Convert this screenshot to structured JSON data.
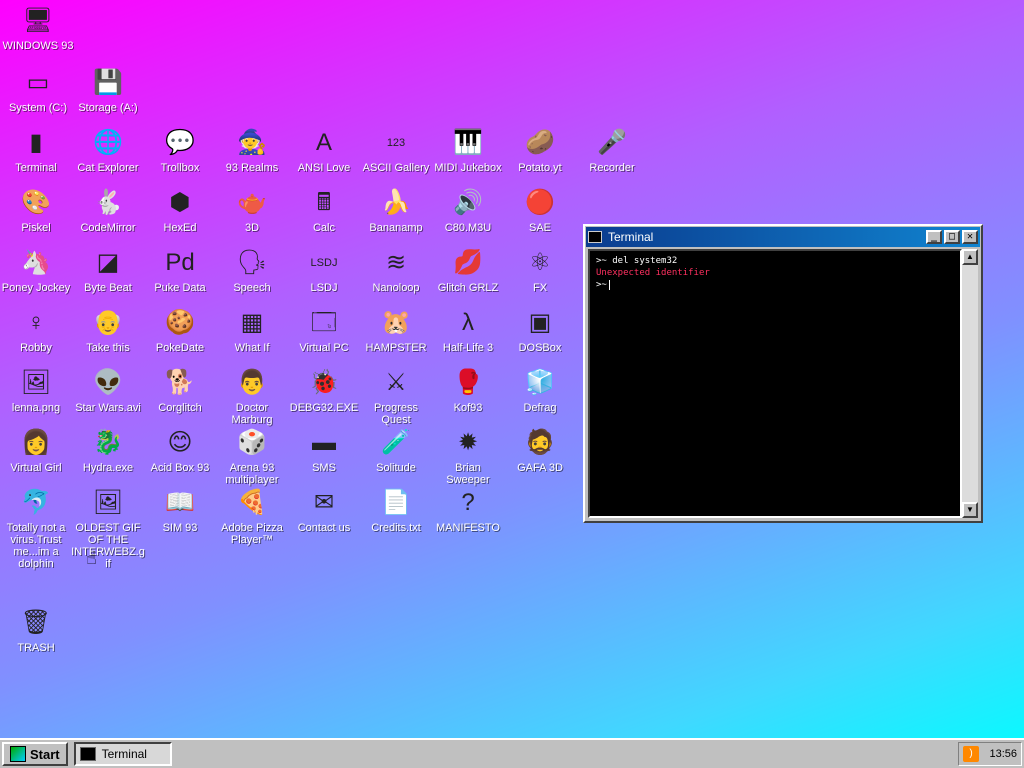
{
  "desktop": {
    "icons": [
      {
        "label": "WINDOWS 93",
        "glyph": "🖥"
      },
      {
        "label": "System (C:)",
        "glyph": "▭"
      },
      {
        "label": "Storage (A:)",
        "glyph": "💾"
      },
      {
        "label": "Terminal",
        "glyph": "▮"
      },
      {
        "label": "Cat Explorer",
        "glyph": "🌐"
      },
      {
        "label": "Trollbox",
        "glyph": "💬"
      },
      {
        "label": "93 Realms",
        "glyph": "🧙"
      },
      {
        "label": "ANSI Love",
        "glyph": "A"
      },
      {
        "label": "ASCII Gallery",
        "glyph": "123"
      },
      {
        "label": "MIDI Jukebox",
        "glyph": "🎹"
      },
      {
        "label": "Potato.yt",
        "glyph": "🥔"
      },
      {
        "label": "Recorder",
        "glyph": "🎤"
      },
      {
        "label": "Piskel",
        "glyph": "🎨"
      },
      {
        "label": "CodeMirror",
        "glyph": "🐇"
      },
      {
        "label": "HexEd",
        "glyph": "⬢"
      },
      {
        "label": "3D",
        "glyph": "🫖"
      },
      {
        "label": "Calc",
        "glyph": "🖩"
      },
      {
        "label": "Bananamp",
        "glyph": "🍌"
      },
      {
        "label": "C80.M3U",
        "glyph": "🔊"
      },
      {
        "label": "SAE",
        "glyph": "🔴"
      },
      {
        "label": "Poney Jockey",
        "glyph": "🦄"
      },
      {
        "label": "Byte Beat",
        "glyph": "◪"
      },
      {
        "label": "Puke Data",
        "glyph": "Pd"
      },
      {
        "label": "Speech",
        "glyph": "🗣"
      },
      {
        "label": "LSDJ",
        "glyph": "LSDJ"
      },
      {
        "label": "Nanoloop",
        "glyph": "≋"
      },
      {
        "label": "Glitch GRLZ",
        "glyph": "💋"
      },
      {
        "label": "FX",
        "glyph": "⚛"
      },
      {
        "label": "Robby",
        "glyph": "♀"
      },
      {
        "label": "Take this",
        "glyph": "👴"
      },
      {
        "label": "PokeDate",
        "glyph": "🍪"
      },
      {
        "label": "What If",
        "glyph": "▦"
      },
      {
        "label": "Virtual PC",
        "glyph": "🗔"
      },
      {
        "label": "HAMPSTER",
        "glyph": "🐹"
      },
      {
        "label": "Half-Life 3",
        "glyph": "λ"
      },
      {
        "label": "DOSBox",
        "glyph": "▣"
      },
      {
        "label": "lenna.png",
        "glyph": "🖼"
      },
      {
        "label": "Star Wars.avi",
        "glyph": "👽"
      },
      {
        "label": "Corglitch",
        "glyph": "🐕"
      },
      {
        "label": "Doctor Marburg",
        "glyph": "👨"
      },
      {
        "label": "DEBG32.EXE",
        "glyph": "🐞"
      },
      {
        "label": "Progress Quest",
        "glyph": "⚔"
      },
      {
        "label": "Kof93",
        "glyph": "🥊"
      },
      {
        "label": "Defrag",
        "glyph": "🧊"
      },
      {
        "label": "Virtual Girl",
        "glyph": "👩"
      },
      {
        "label": "Hydra.exe",
        "glyph": "🐉"
      },
      {
        "label": "Acid Box 93",
        "glyph": "😊"
      },
      {
        "label": "Arena 93 multiplayer",
        "glyph": "🎲"
      },
      {
        "label": "SMS",
        "glyph": "▬"
      },
      {
        "label": "Solitude",
        "glyph": "🧪"
      },
      {
        "label": "Brian Sweeper",
        "glyph": "✹"
      },
      {
        "label": "GAFA 3D",
        "glyph": "🧔"
      },
      {
        "label": "Totally not a virus.Trust me...im a dolphin",
        "glyph": "🐬"
      },
      {
        "label": "OLDEST GIF OF THE INTERWEBZ.gif",
        "glyph": "🖼"
      },
      {
        "label": "SIM 93",
        "glyph": "📖"
      },
      {
        "label": "Adobe Pizza Player™",
        "glyph": "🍕"
      },
      {
        "label": "Contact us",
        "glyph": "✉"
      },
      {
        "label": "Credits.txt",
        "glyph": "📄"
      },
      {
        "label": "MANIFESTO",
        "glyph": "?"
      },
      {
        "label": "TRASH",
        "glyph": "🗑"
      }
    ]
  },
  "terminal": {
    "title": "Terminal",
    "minimize": "_",
    "maximize": "□",
    "close": "✕",
    "scroll_up": "▲",
    "scroll_down": "▼",
    "lines": [
      {
        "text": ">~ del system32",
        "kind": "cmd"
      },
      {
        "text": "Unexpected identifier",
        "kind": "err"
      },
      {
        "text": ">~",
        "kind": "prompt"
      }
    ]
  },
  "taskbar": {
    "start_label": "Start",
    "task_label": "Terminal",
    "clock": "13:56",
    "rss_glyph": ")"
  },
  "cursor_glyph": "☝"
}
